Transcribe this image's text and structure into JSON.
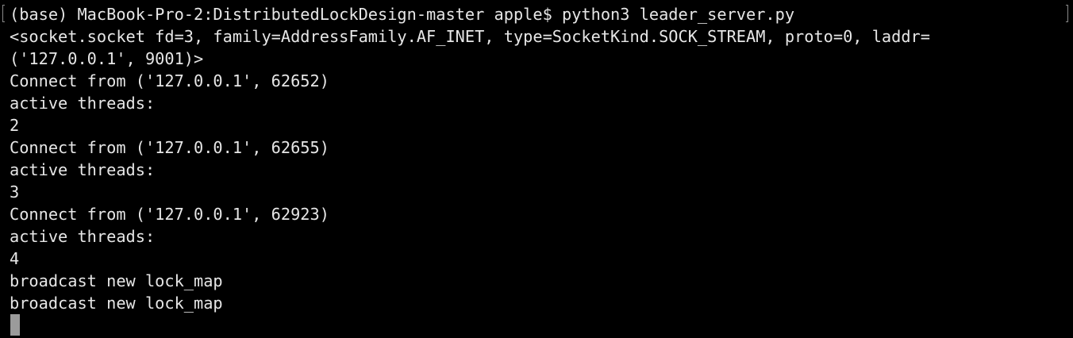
{
  "terminal": {
    "lines": [
      "(base) MacBook-Pro-2:DistributedLockDesign-master apple$ python3 leader_server.py",
      "<socket.socket fd=3, family=AddressFamily.AF_INET, type=SocketKind.SOCK_STREAM, proto=0, laddr=",
      "('127.0.0.1', 9001)>",
      "Connect from ('127.0.0.1', 62652)",
      "active threads:",
      "2",
      "Connect from ('127.0.0.1', 62655)",
      "active threads:",
      "3",
      "Connect from ('127.0.0.1', 62923)",
      "active threads:",
      "4",
      "broadcast new lock_map",
      "broadcast new lock_map"
    ]
  }
}
